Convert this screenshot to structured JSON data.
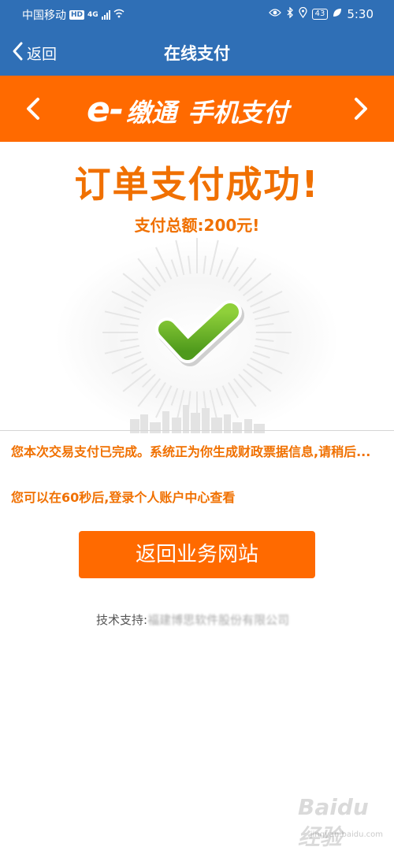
{
  "status_bar": {
    "carrier": "中国移动",
    "hd": "HD",
    "net": "4G",
    "battery": "43",
    "time": "5:30"
  },
  "nav": {
    "back_label": "返回",
    "title": "在线支付"
  },
  "banner": {
    "brand_e": "e-",
    "brand_name": "缴通",
    "brand_sub": "手机支付"
  },
  "result": {
    "title": "订单支付成功!",
    "amount": "支付总额:200元!"
  },
  "message": {
    "line1": "您本次交易支付已完成。系统正为你生成财政票据信息,请稍后...",
    "line2": "您可以在60秒后,登录个人账户中心查看"
  },
  "actions": {
    "return_label": "返回业务网站"
  },
  "footer": {
    "support_label": "技术支持:",
    "support_company": "福建博思软件股份有限公司"
  },
  "watermark": {
    "main": "Baidu 经验",
    "sub": "jingyan.baidu.com"
  },
  "colors": {
    "header_blue": "#2f6fb6",
    "accent_orange": "#ff6a00",
    "text_orange": "#f07000",
    "check_green": "#6fb22b"
  }
}
